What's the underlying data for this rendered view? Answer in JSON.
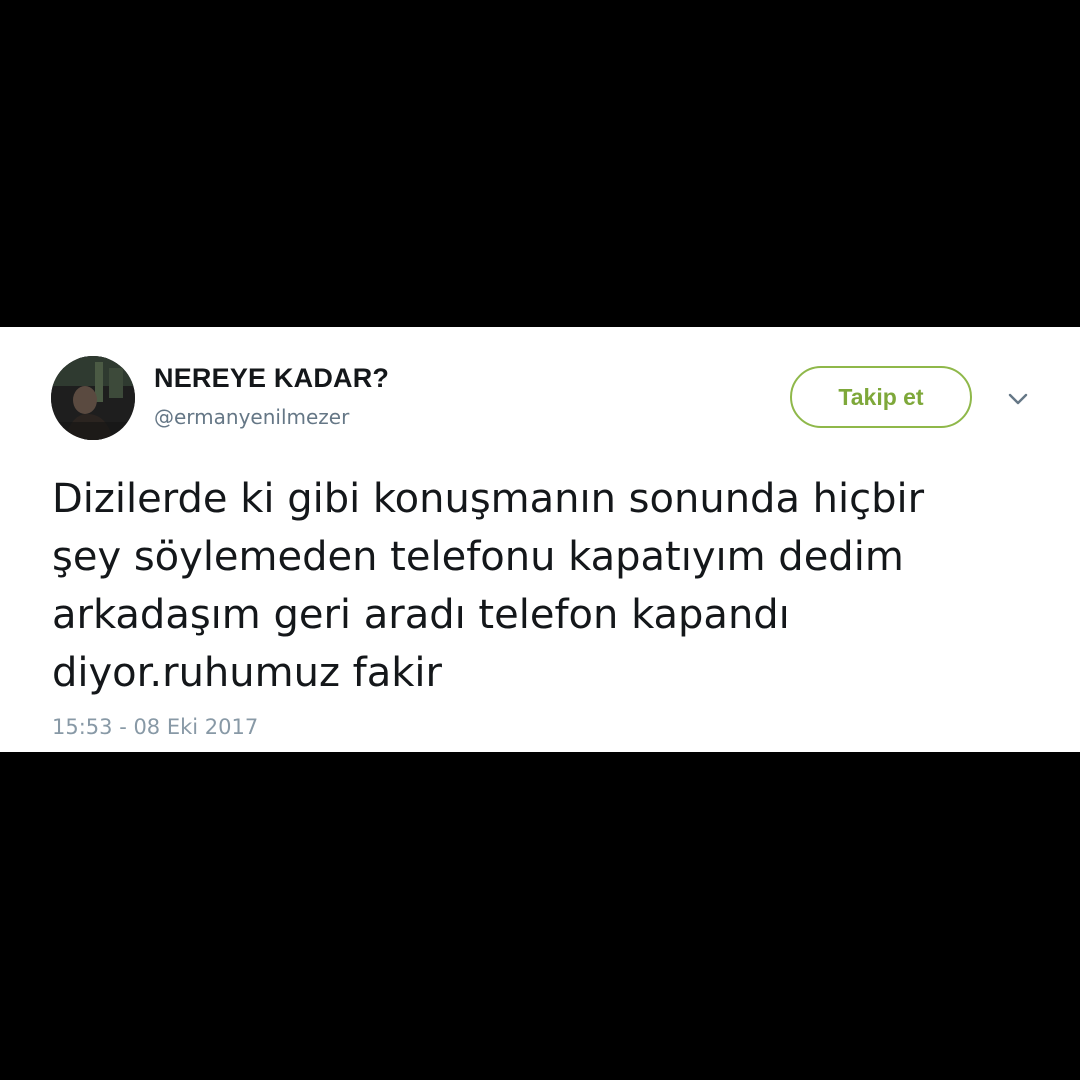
{
  "tweet": {
    "author": {
      "display_name": "NEREYE KADAR?",
      "handle": "@ermanyenilmezer",
      "avatar_icon": "user-avatar"
    },
    "follow_button_label": "Takip et",
    "more_menu_icon": "chevron-down-icon",
    "text_lines": [
      "Dizilerde ki gibi konuşmanın sonunda hiçbir",
      "şey söylemeden telefonu kapatıyım dedim",
      "arkadaşım geri aradı telefon kapandı",
      "diyor.ruhumuz fakir"
    ],
    "timestamp": "15:53 - 08 Eki 2017"
  },
  "colors": {
    "background": "#000000",
    "card": "#ffffff",
    "follow_accent": "#7ea83a",
    "text": "#14171a",
    "secondary_text": "#657786"
  }
}
